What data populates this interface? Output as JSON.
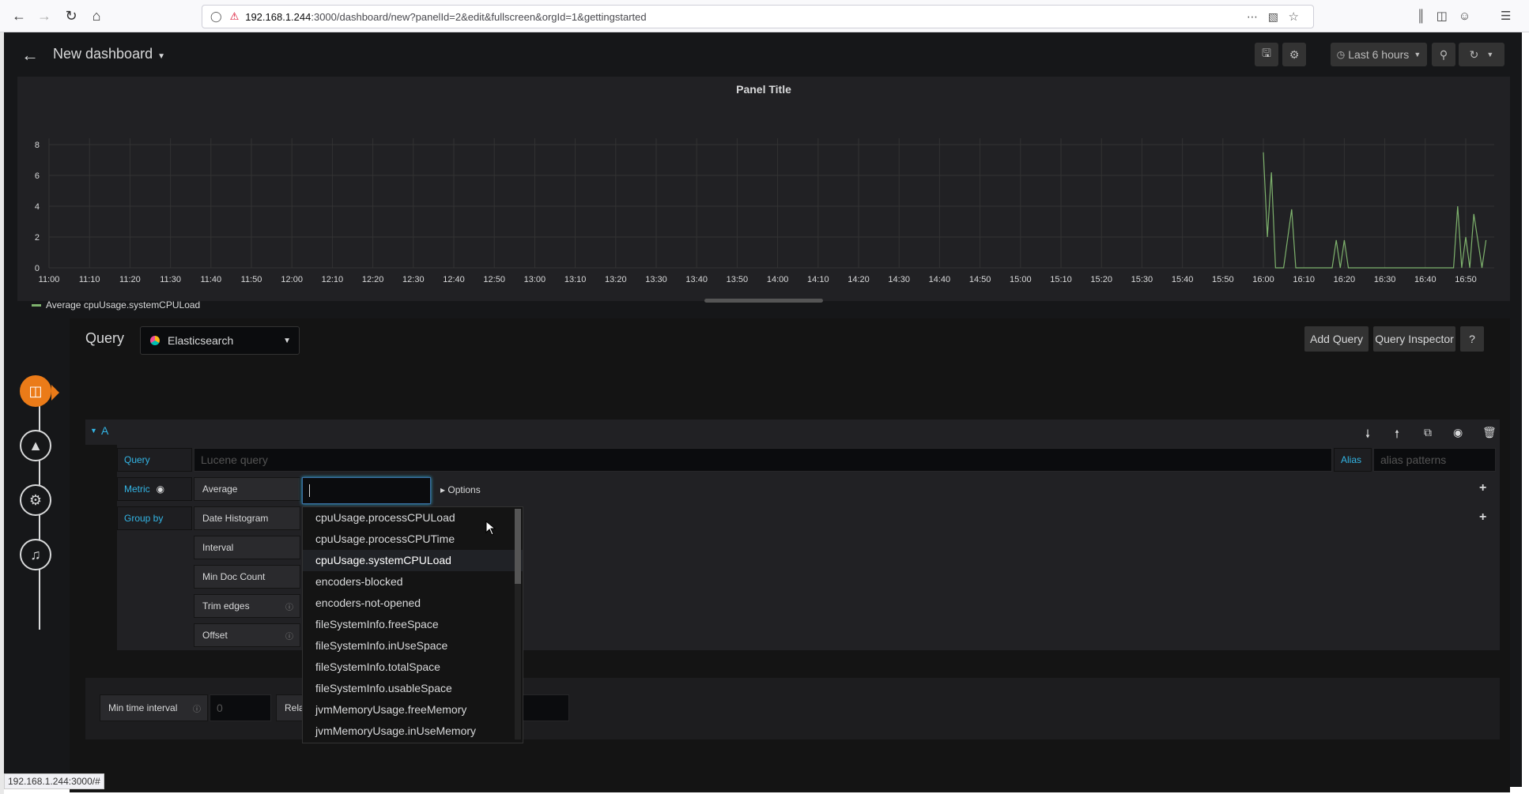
{
  "browser": {
    "url_host": "192.168.1.244",
    "url_rest": ":3000/dashboard/new?panelId=2&edit&fullscreen&orgId=1&gettingstarted",
    "status_url": "192.168.1.244:3000/#"
  },
  "header": {
    "title": "New dashboard",
    "time_range": "Last 6 hours"
  },
  "panel": {
    "title": "Panel Title",
    "legend": "Average cpuUsage.systemCPULoad"
  },
  "chart_data": {
    "type": "line",
    "title": "Panel Title",
    "y_ticks": [
      "0",
      "2",
      "4",
      "6",
      "8"
    ],
    "ylim": [
      0,
      8
    ],
    "x_ticks": [
      "11:00",
      "11:10",
      "11:20",
      "11:30",
      "11:40",
      "11:50",
      "12:00",
      "12:10",
      "12:20",
      "12:30",
      "12:40",
      "12:50",
      "13:00",
      "13:10",
      "13:20",
      "13:30",
      "13:40",
      "13:50",
      "14:00",
      "14:10",
      "14:20",
      "14:30",
      "14:40",
      "14:50",
      "15:00",
      "15:10",
      "15:20",
      "15:30",
      "15:40",
      "15:50",
      "16:00",
      "16:10",
      "16:20",
      "16:30",
      "16:40",
      "16:50"
    ],
    "series": [
      {
        "name": "Average cpuUsage.systemCPULoad",
        "color": "#7eb26d",
        "points": [
          [
            "16:00",
            7.5
          ],
          [
            "16:01",
            2
          ],
          [
            "16:02",
            6.2
          ],
          [
            "16:03",
            0
          ],
          [
            "16:05",
            0
          ],
          [
            "16:07",
            3.8
          ],
          [
            "16:08",
            0
          ],
          [
            "16:17",
            0
          ],
          [
            "16:18",
            1.8
          ],
          [
            "16:19",
            0
          ],
          [
            "16:20",
            1.8
          ],
          [
            "16:21",
            0
          ],
          [
            "16:47",
            0
          ],
          [
            "16:48",
            4
          ],
          [
            "16:49",
            0
          ],
          [
            "16:50",
            2
          ],
          [
            "16:51",
            0
          ],
          [
            "16:52",
            3.5
          ],
          [
            "16:54",
            0
          ],
          [
            "16:55",
            1.8
          ]
        ]
      }
    ]
  },
  "query": {
    "label": "Query",
    "datasource": "Elasticsearch",
    "add_query": "Add Query",
    "inspector": "Query Inspector",
    "help": "?",
    "ref_id": "A",
    "row_query_label": "Query",
    "lucene_placeholder": "Lucene query",
    "alias_label": "Alias",
    "alias_placeholder": "alias patterns",
    "metric_label": "Metric",
    "metric_type": "Average",
    "options_label": "Options",
    "group_by_label": "Group by",
    "group_by_type": "Date Histogram",
    "interval_label": "Interval",
    "min_doc_label": "Min Doc Count",
    "trim_label": "Trim edges",
    "offset_label": "Offset",
    "min_time_label": "Min time interval",
    "min_time_value": "0",
    "relative_label": "Rela"
  },
  "field_dropdown": [
    "cpuUsage.processCPULoad",
    "cpuUsage.processCPUTime",
    "cpuUsage.systemCPULoad",
    "encoders-blocked",
    "encoders-not-opened",
    "fileSystemInfo.freeSpace",
    "fileSystemInfo.inUseSpace",
    "fileSystemInfo.totalSpace",
    "fileSystemInfo.usableSpace",
    "jvmMemoryUsage.freeMemory",
    "jvmMemoryUsage.inUseMemory"
  ],
  "highlighted_field": "cpuUsage.systemCPULoad"
}
